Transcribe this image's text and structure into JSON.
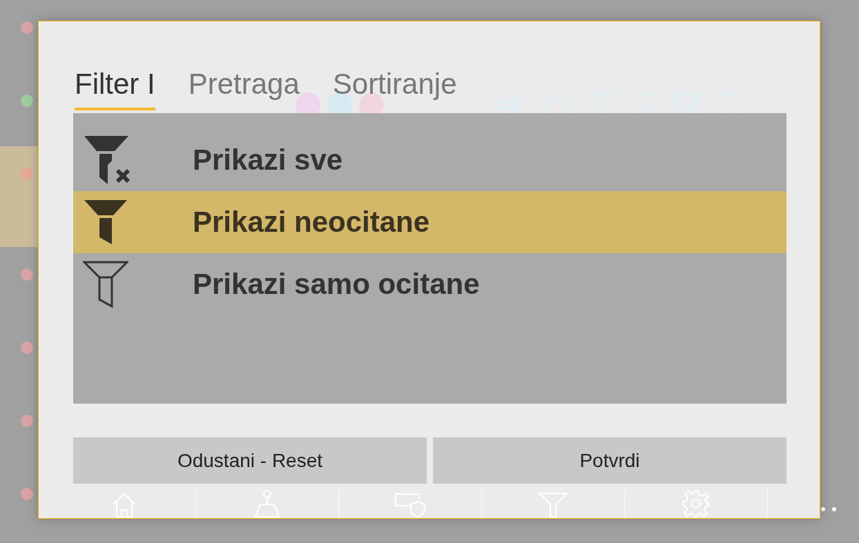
{
  "customers": [
    {
      "color": "#d9a3a3",
      "selected": false
    },
    {
      "color": "#9ccc9c",
      "selected": false
    },
    {
      "color": "#e8a898",
      "selected": true
    },
    {
      "color": "#d9a3a3",
      "selected": false
    },
    {
      "color": "#d9a3a3",
      "selected": false
    },
    {
      "color": "#d9a3a3",
      "selected": false
    },
    {
      "color": "#d9a3a3",
      "selected": false
    }
  ],
  "detail": {
    "badges": [
      {
        "color": "#eed6ee"
      },
      {
        "color": "#d6ecf2"
      },
      {
        "color": "#f2d6de"
      }
    ]
  },
  "dialog": {
    "tabs": [
      {
        "label": "Filter I",
        "selected": true
      },
      {
        "label": "Pretraga",
        "selected": false
      },
      {
        "label": "Sortiranje",
        "selected": false
      }
    ],
    "options": [
      {
        "label": "Prikazi sve",
        "kind": "clear",
        "selected": false
      },
      {
        "label": "Prikazi neocitane",
        "kind": "filled",
        "selected": true
      },
      {
        "label": "Prikazi samo ocitane",
        "kind": "outline",
        "selected": false
      }
    ],
    "buttons": [
      "Odustani - Reset",
      "Potvrdi"
    ]
  }
}
